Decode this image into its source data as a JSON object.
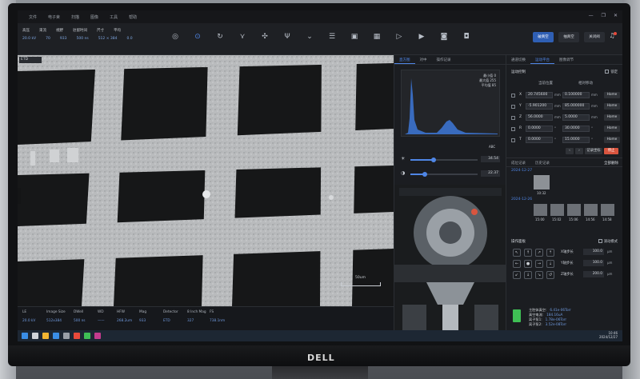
{
  "menubar": {
    "items": [
      "文件",
      "电子束",
      "扫描",
      "图像",
      "工具",
      "帮助"
    ]
  },
  "toolbar": {
    "labels": [
      "高压",
      "束流",
      "视野",
      "驻留时间",
      "尺寸",
      "平均"
    ],
    "values": [
      "20.0 kV",
      "70",
      "933",
      "500 ns",
      "512 × 384",
      "0.0"
    ],
    "buttons": {
      "vent": "破真空",
      "pump": "抽真空",
      "close": "关闭阀"
    }
  },
  "image_area": {
    "detector": "ETD",
    "scale_label": "50um"
  },
  "infobar": {
    "headers": [
      "LE",
      "Image Size",
      "DWell",
      "WD",
      "HFW",
      "Mag",
      "Detector",
      "8 Inch Mag",
      "FS"
    ],
    "values": [
      "20.0 kV",
      "512x384",
      "500 ns",
      "——",
      "268.2um",
      "933",
      "ETD",
      "327",
      "738.1nm"
    ]
  },
  "mid_panel": {
    "tabs": [
      "直方图",
      "对中",
      "操作记录"
    ],
    "histogram": {
      "min_label": "最小值",
      "min": "0",
      "max_label": "最大值",
      "max": "255",
      "avg_label": "平均值",
      "avg": "85"
    },
    "abc": "ABC",
    "brightness": {
      "value": "34.54",
      "fraction": 0.35
    },
    "contrast": {
      "value": "22.37",
      "fraction": 0.22
    }
  },
  "right_panel": {
    "tabs": [
      "通道切换",
      "运动平台",
      "图像调节"
    ],
    "stage_title": "运动控制",
    "lock_label": "锁定",
    "col_current": "当前位置",
    "col_relative": "相对移动",
    "rows": [
      {
        "axis": "X",
        "pos": "20.745600",
        "unit1": "mm",
        "rel": "0.100000",
        "unit2": "mm",
        "home": "Home"
      },
      {
        "axis": "Y",
        "pos": "-5.901200",
        "unit1": "mm",
        "rel": "85.000000",
        "unit2": "mm",
        "home": "Home"
      },
      {
        "axis": "Z",
        "pos": "56.0000",
        "unit1": "mm",
        "rel": "5.0000",
        "unit2": "mm",
        "home": "Home"
      },
      {
        "axis": "R",
        "pos": "0.0000",
        "unit1": "°",
        "rel": "30.0000",
        "unit2": "°",
        "home": "Home"
      },
      {
        "axis": "T",
        "pos": "0.0000",
        "unit1": "°",
        "rel": "15.0000",
        "unit2": "°",
        "home": "Home"
      }
    ],
    "record_label": "记录坐标",
    "stop_label": "停止",
    "history_tabs": [
      "成位记录",
      "历史记录"
    ],
    "clear_label": "全部删除",
    "date1": "2024-12-27",
    "thumb1_time": "10:32",
    "date2": "2024-12-26",
    "thumb_times": [
      "15:00",
      "15:02",
      "15:06",
      "14:56",
      "14:58"
    ],
    "ops_title": "操作面板",
    "ops_check": "滚动模式",
    "steps": [
      {
        "label": "X轴步长",
        "value": "100.0",
        "unit": "μm"
      },
      {
        "label": "Y轴步长",
        "value": "100.0",
        "unit": "μm"
      },
      {
        "label": "Z轴步长",
        "value": "200.0",
        "unit": "μm"
      }
    ],
    "status": [
      {
        "k": "主腔体真空:",
        "v": "6.41e-06Torr"
      },
      {
        "k": "真空电流:",
        "v": "184.16uA"
      },
      {
        "k": "离子泵1:",
        "v": "1.78e-06Torr"
      },
      {
        "k": "离子泵2:",
        "v": "3.52e-08Torr"
      }
    ]
  },
  "taskbar": {
    "time": "10:46",
    "date": "2024/12/27"
  },
  "brand": {
    "logo": "DELL"
  },
  "colors": {
    "accent": "#4f86e6",
    "stop": "#d9553f",
    "status_ok": "#3fbf55"
  }
}
